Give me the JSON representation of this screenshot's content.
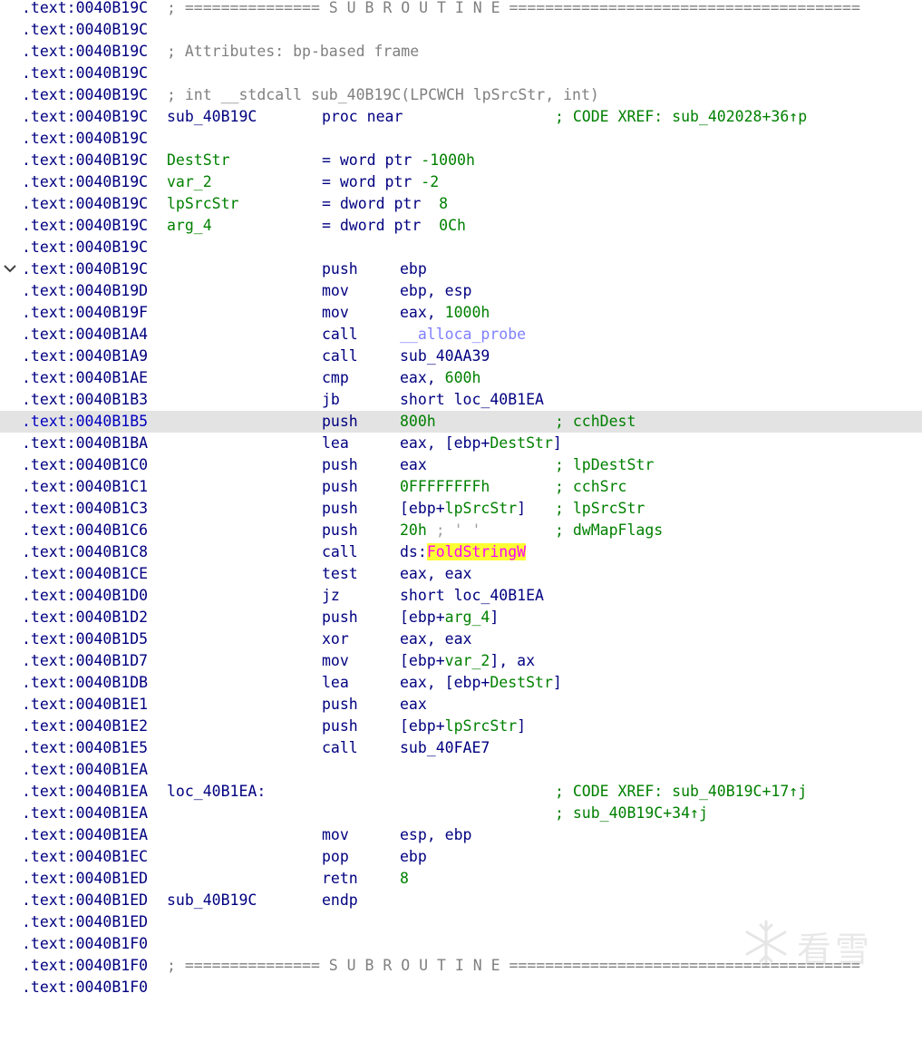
{
  "addresses": [
    ".text:0040B19C",
    ".text:0040B19C",
    ".text:0040B19C",
    ".text:0040B19C",
    ".text:0040B19C",
    ".text:0040B19C",
    ".text:0040B19C",
    ".text:0040B19C",
    ".text:0040B19C",
    ".text:0040B19C",
    ".text:0040B19C",
    ".text:0040B19C",
    ".text:0040B19C",
    ".text:0040B19D",
    ".text:0040B19F",
    ".text:0040B1A4",
    ".text:0040B1A9",
    ".text:0040B1AE",
    ".text:0040B1B3",
    ".text:0040B1B5",
    ".text:0040B1BA",
    ".text:0040B1C0",
    ".text:0040B1C1",
    ".text:0040B1C3",
    ".text:0040B1C6",
    ".text:0040B1C8",
    ".text:0040B1CE",
    ".text:0040B1D0",
    ".text:0040B1D2",
    ".text:0040B1D5",
    ".text:0040B1D7",
    ".text:0040B1DB",
    ".text:0040B1E1",
    ".text:0040B1E2",
    ".text:0040B1E5",
    ".text:0040B1EA",
    ".text:0040B1EA",
    ".text:0040B1EA",
    ".text:0040B1EA",
    ".text:0040B1EC",
    ".text:0040B1ED",
    ".text:0040B1ED",
    ".text:0040B1ED",
    ".text:0040B1F0",
    ".text:0040B1F0",
    ".text:0040B1F0"
  ],
  "header": {
    "subroutine_banner_1": "; =============== S U B R O U T I N E =======================================",
    "attributes": "; Attributes: bp-based frame",
    "prototype": "; int __stdcall sub_40B19C(LPCWCH lpSrcStr, int)",
    "subroutine_banner_2": "; =============== S U B R O U T I N E ======================================="
  },
  "proc": {
    "name": "sub_40B19C",
    "start_kw": "proc near",
    "xref": "; CODE XREF: sub_402028+36↑p",
    "end_kw": "endp"
  },
  "locals": [
    {
      "name": "DestStr",
      "eq": "= word ptr ",
      "val": "-1000h"
    },
    {
      "name": "var_2",
      "eq": "= word ptr ",
      "val": "-2"
    },
    {
      "name": "lpSrcStr",
      "eq": "= dword ptr  ",
      "val": "8"
    },
    {
      "name": "arg_4",
      "eq": "= dword ptr  ",
      "val": "0Ch"
    }
  ],
  "code": {
    "l12": {
      "mn": "push",
      "op": "ebp"
    },
    "l13": {
      "mn": "mov",
      "op": "ebp, esp"
    },
    "l14": {
      "mn": "mov",
      "op_a": "eax, ",
      "op_b": "1000h"
    },
    "l15": {
      "mn": "call",
      "op": "__alloca_probe"
    },
    "l16": {
      "mn": "call",
      "op": "sub_40AA39"
    },
    "l17": {
      "mn": "cmp",
      "op_a": "eax, ",
      "op_b": "600h"
    },
    "l18": {
      "mn": "jb",
      "op": "short loc_40B1EA"
    },
    "l19": {
      "mn": "push",
      "op": "800h",
      "cm": "; cchDest"
    },
    "l20": {
      "mn": "lea",
      "op_a": "eax, [ebp+",
      "op_b": "DestStr",
      "op_c": "]"
    },
    "l21": {
      "mn": "push",
      "op": "eax",
      "cm": "; lpDestStr"
    },
    "l22": {
      "mn": "push",
      "op": "0FFFFFFFFh",
      "cm": "; cchSrc"
    },
    "l23": {
      "mn": "push",
      "op_a": "[ebp+",
      "op_b": "lpSrcStr",
      "op_c": "]",
      "cm": "; lpSrcStr"
    },
    "l24": {
      "mn": "push",
      "op": "20h",
      "op_cmt": " ; ' '",
      "cm": "; dwMapFlags"
    },
    "l25": {
      "mn": "call",
      "op_a": "ds:",
      "op_b": "FoldStringW"
    },
    "l26": {
      "mn": "test",
      "op": "eax, eax"
    },
    "l27": {
      "mn": "jz",
      "op": "short loc_40B1EA"
    },
    "l28": {
      "mn": "push",
      "op_a": "[ebp+",
      "op_b": "arg_4",
      "op_c": "]"
    },
    "l29": {
      "mn": "xor",
      "op": "eax, eax"
    },
    "l30": {
      "mn": "mov",
      "op_a": "[ebp+",
      "op_b": "var_2",
      "op_c": "], ax"
    },
    "l31": {
      "mn": "lea",
      "op_a": "eax, [ebp+",
      "op_b": "DestStr",
      "op_c": "]"
    },
    "l32": {
      "mn": "push",
      "op": "eax"
    },
    "l33": {
      "mn": "push",
      "op_a": "[ebp+",
      "op_b": "lpSrcStr",
      "op_c": "]"
    },
    "l34": {
      "mn": "call",
      "op": "sub_40FAE7"
    },
    "l36": {
      "label": "loc_40B1EA:",
      "cm": "; CODE XREF: sub_40B19C+17↑j"
    },
    "l37": {
      "cm": "; sub_40B19C+34↑j"
    },
    "l38": {
      "mn": "mov",
      "op": "esp, ebp"
    },
    "l39": {
      "mn": "pop",
      "op": "ebp"
    },
    "l40": {
      "mn": "retn",
      "op": "8"
    }
  },
  "watermark": {
    "text": "看雪"
  },
  "colors": {
    "address": "#000080",
    "highlight_row": "#e3e3e3",
    "comment": "#008000",
    "header_comment": "#808080",
    "library_func": "#8080ff",
    "import_func": "#ff00ff",
    "import_bg": "#ffff33"
  },
  "icons": {
    "fold": "chevron-down-icon",
    "watermark": "snowflake-icon"
  }
}
